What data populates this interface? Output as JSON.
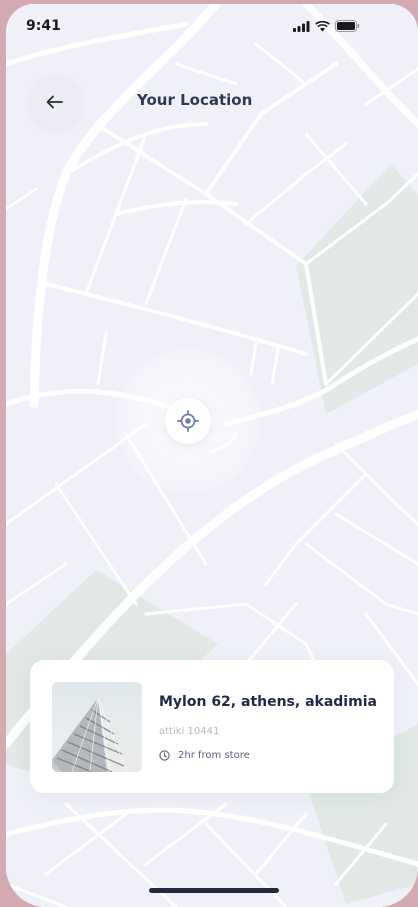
{
  "status_bar": {
    "time": "9:41",
    "icons": [
      "signal-icon",
      "wifi-icon",
      "battery-icon"
    ]
  },
  "header": {
    "back_icon": "arrow-left-icon",
    "title": "Your Location"
  },
  "map": {
    "locator_icon": "crosshair-icon",
    "colors": {
      "background": "#f0f1f8",
      "roads": "#ffffff",
      "parks": "#e1e8e6"
    }
  },
  "location_card": {
    "address": "Mylon 62, athens, akadimia",
    "postcode": "attiki 10441",
    "eta_icon": "clock-icon",
    "eta": "2hr from store",
    "image": "building-photo"
  },
  "colors": {
    "page_background": "#d4a9b1",
    "title_text": "#2e3a4f",
    "card_background": "#ffffff",
    "home_indicator": "#232a3d"
  }
}
